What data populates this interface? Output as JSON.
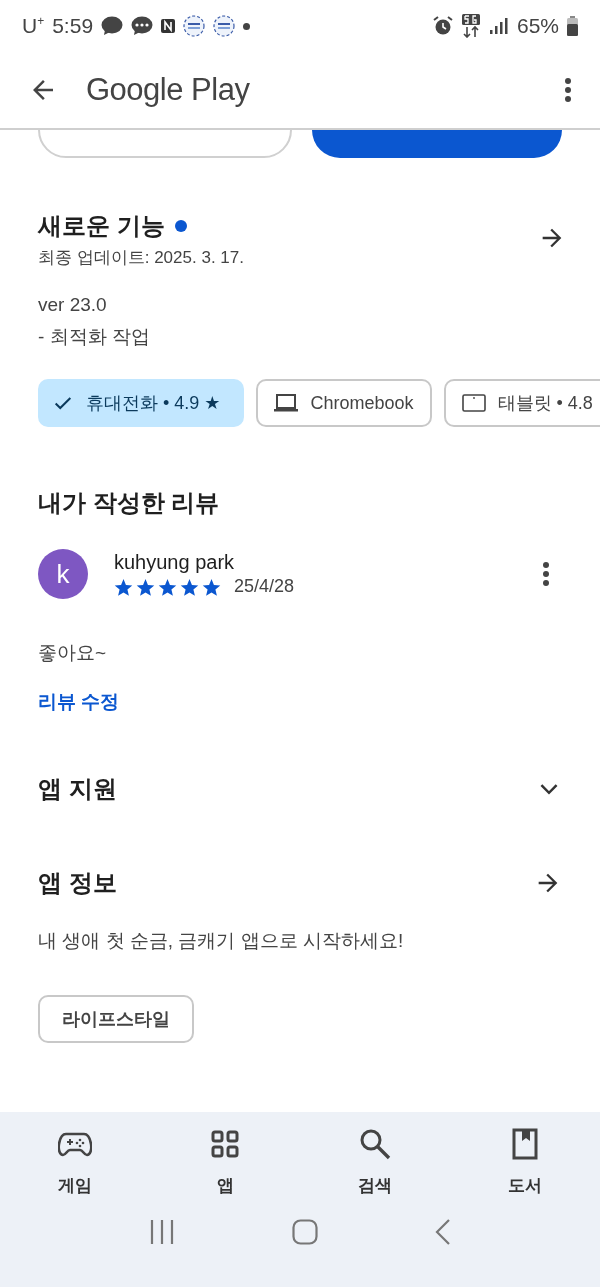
{
  "status_bar": {
    "carrier": "U$^{+}$",
    "time": "5:59",
    "battery": "65%"
  },
  "app_bar": {
    "title": "Google Play"
  },
  "whats_new": {
    "title": "새로운 기능",
    "new": true,
    "updated": "최종 업데이트: 2025. 3. 17.",
    "version": "ver 23.0",
    "notes": "- 최적화 작업"
  },
  "devices": [
    {
      "label": "휴대전화 • 4.9 ★",
      "kind": "phone",
      "selected": true
    },
    {
      "label": "Chromebook",
      "kind": "laptop",
      "selected": false
    },
    {
      "label": "태블릿 • 4.8",
      "kind": "tablet",
      "selected": false
    }
  ],
  "my_review": {
    "title": "내가 작성한 리뷰",
    "avatar": "k",
    "author": "kuhyung park",
    "stars": 5,
    "date": "25/4/28",
    "text": "좋아요~",
    "edit_link": "리뷰 수정"
  },
  "sections": [
    {
      "title": "앱 지원",
      "kind": "expand"
    },
    {
      "title": "앱 정보",
      "kind": "arrow",
      "description": "내 생애 첫 순금, 금캐기 앱으로 시작하세요!"
    }
  ],
  "tags": [
    "라이프스타일"
  ],
  "bottom_nav": [
    {
      "label": "게임",
      "kind": "games"
    },
    {
      "label": "앱",
      "kind": "apps"
    },
    {
      "label": "검색",
      "kind": "search"
    },
    {
      "label": "도서",
      "kind": "books"
    }
  ]
}
